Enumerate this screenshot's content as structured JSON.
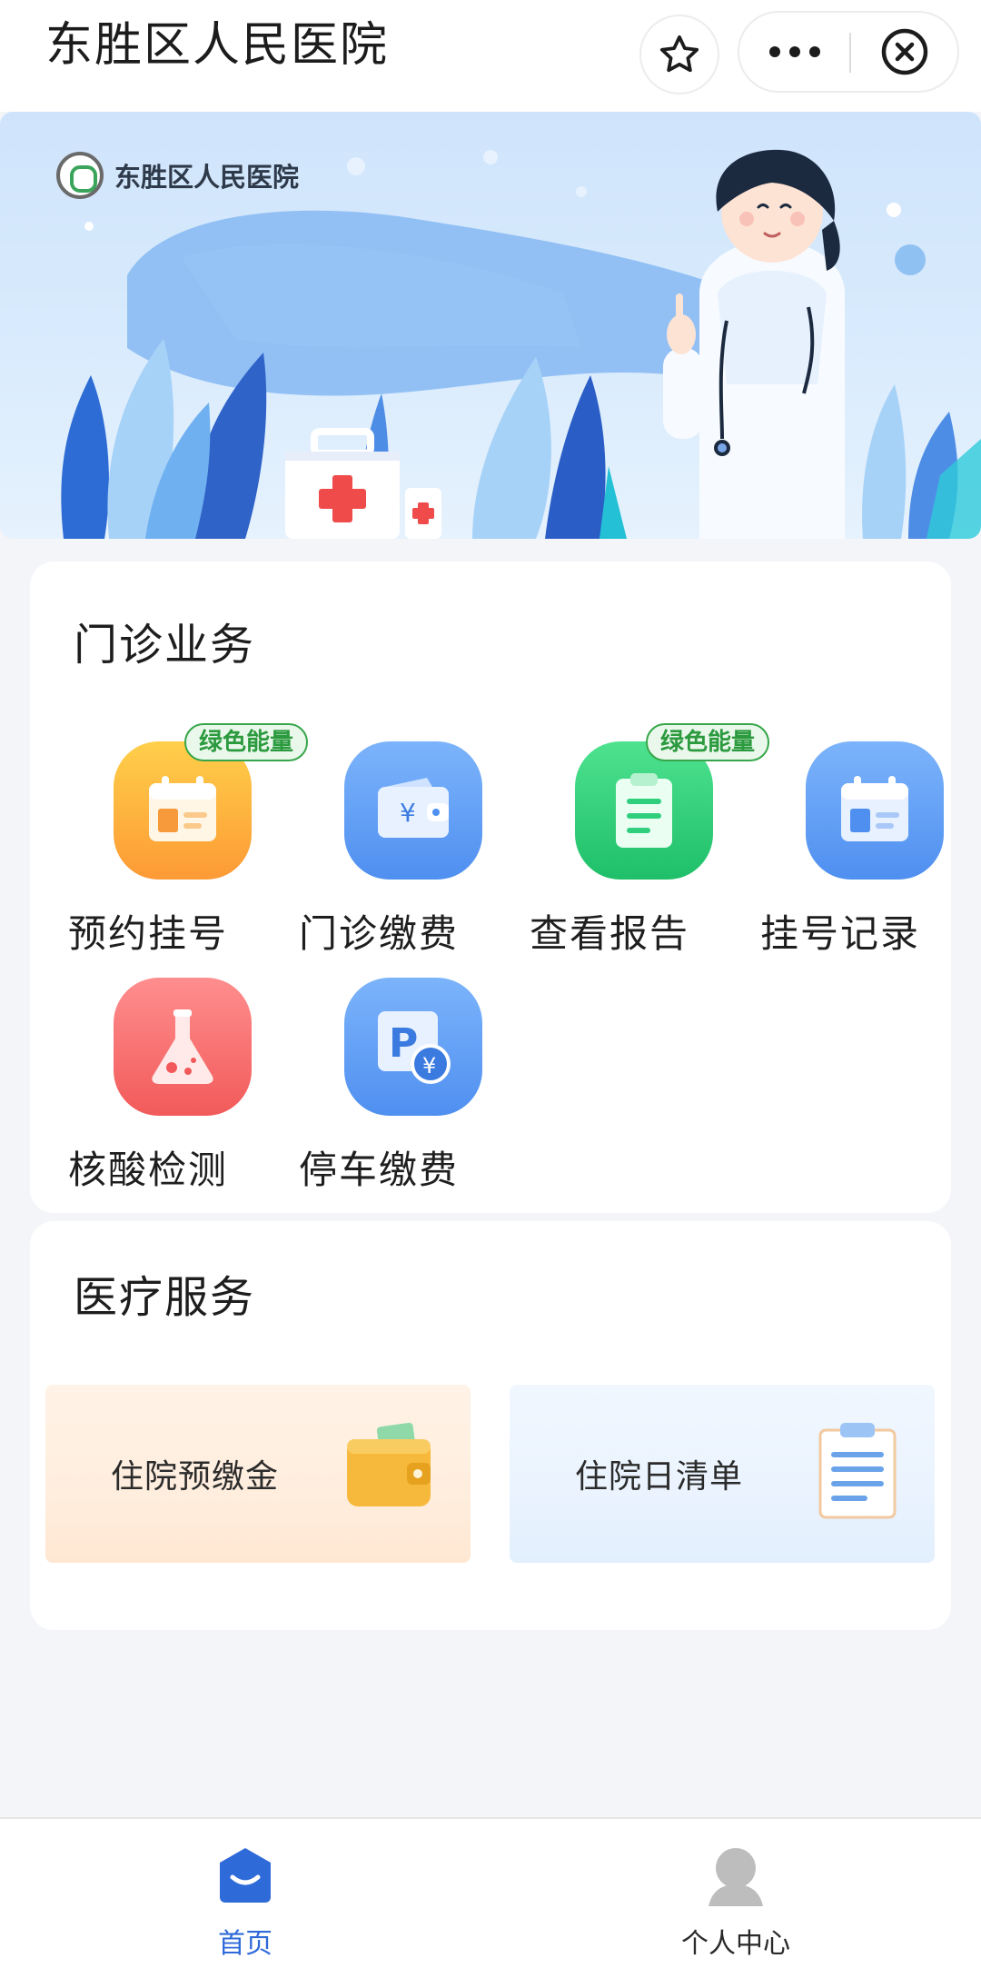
{
  "header": {
    "title": "东胜区人民医院",
    "icons": [
      "star-icon",
      "more-icon",
      "close-icon"
    ]
  },
  "banner": {
    "logo_text": "东胜区人民医院"
  },
  "outpatient": {
    "title": "门诊业务",
    "services": [
      {
        "label": "预约挂号",
        "badge": "绿色能量",
        "icon": "calendar-icon",
        "color": "#fbac3c"
      },
      {
        "label": "门诊缴费",
        "icon": "wallet-icon",
        "color": "#4f8ff0"
      },
      {
        "label": "查看报告",
        "badge": "绿色能量",
        "icon": "report-icon",
        "color": "#2fcf7e"
      },
      {
        "label": "挂号记录",
        "icon": "calendar-icon",
        "color": "#4f8ff0"
      },
      {
        "label": "核酸检测",
        "icon": "flask-icon",
        "color": "#f66b6b"
      },
      {
        "label": "停车缴费",
        "icon": "parking-icon",
        "color": "#4f8ff0"
      }
    ]
  },
  "medical": {
    "title": "医疗服务",
    "tiles": [
      {
        "label": "住院预缴金",
        "icon": "wallet-icon"
      },
      {
        "label": "住院日清单",
        "icon": "clipboard-icon"
      }
    ]
  },
  "nav": {
    "items": [
      {
        "label": "首页",
        "icon": "home-icon",
        "active": true
      },
      {
        "label": "个人中心",
        "icon": "user-icon",
        "active": false
      }
    ]
  },
  "colors": {
    "accent": "#2f6ad9",
    "badge_green": "#37a64a"
  }
}
